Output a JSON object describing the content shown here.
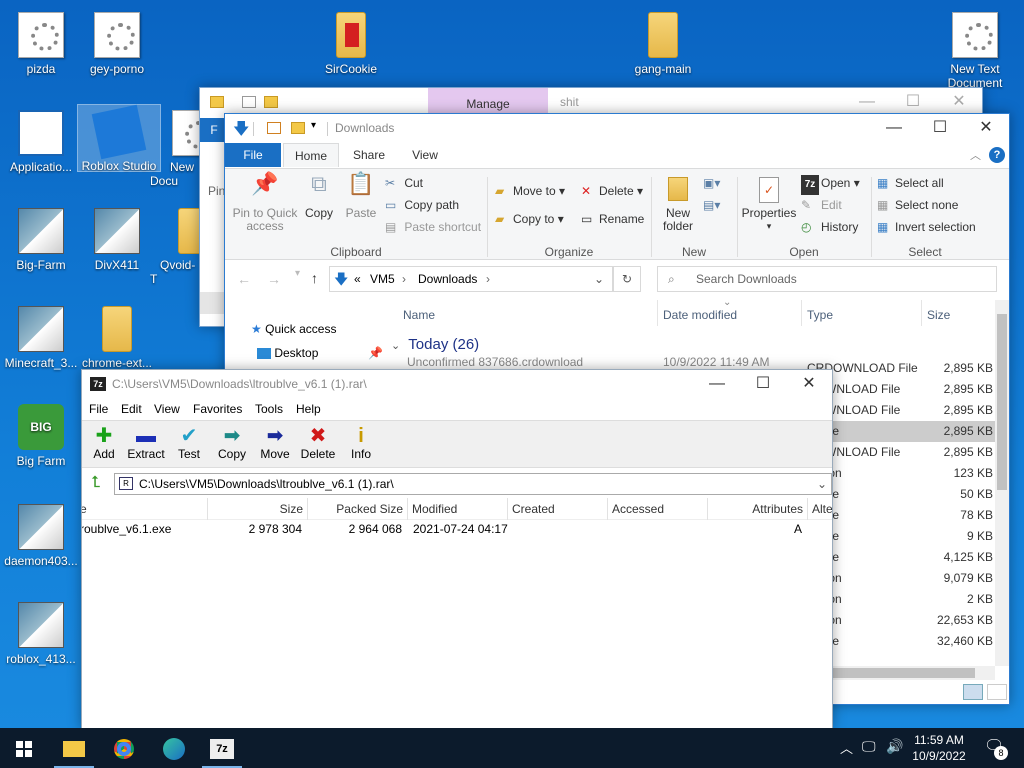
{
  "colors": {
    "accent": "#0078d7",
    "desktop": "#127fd8",
    "taskbar": "#0c1b2c",
    "ribbon_file": "#1a6fc4",
    "manage_tab": "#e4c8ef"
  },
  "desktop_icons": [
    {
      "label": "pizda",
      "icon": "text-file-icon"
    },
    {
      "label": "gey-porno",
      "icon": "text-file-icon"
    },
    {
      "label": "SirCookie",
      "icon": "archive-icon"
    },
    {
      "label": "gang-main",
      "icon": "archive-icon"
    },
    {
      "label": "New Text Document",
      "icon": "text-file-icon"
    },
    {
      "label": "Applicatio...",
      "icon": "window-icon"
    },
    {
      "label": "Roblox Studio",
      "icon": "roblox-icon"
    },
    {
      "label": "New Docu",
      "icon": "text-file-icon"
    },
    {
      "label": "Big-Farm",
      "icon": "setup-icon"
    },
    {
      "label": "DivX411",
      "icon": "setup-icon"
    },
    {
      "label": "Qvoid-T",
      "icon": "folder-icon"
    },
    {
      "label": "Minecraft_3...",
      "icon": "setup-icon"
    },
    {
      "label": "chrome-ext...",
      "icon": "folder-icon"
    },
    {
      "label": "Big Farm",
      "icon": "game-icon"
    },
    {
      "label": "daemon403...",
      "icon": "setup-icon"
    },
    {
      "label": "roblox_413...",
      "icon": "setup-icon"
    }
  ],
  "back_window": {
    "manage_tab": "Manage",
    "title": "shit",
    "file_tab": "F",
    "pin_label": "Pin"
  },
  "explorer": {
    "title": "Downloads",
    "tabs": [
      "File",
      "Home",
      "Share",
      "View"
    ],
    "clipboard": {
      "pin": "Pin to Quick access",
      "copy": "Copy",
      "paste": "Paste",
      "cut": "Cut",
      "copy_path": "Copy path",
      "paste_shortcut": "Paste shortcut",
      "group": "Clipboard"
    },
    "organize": {
      "move_to": "Move to",
      "copy_to": "Copy to",
      "delete": "Delete",
      "rename": "Rename",
      "group": "Organize"
    },
    "new": {
      "new_folder": "New folder",
      "group": "New"
    },
    "open": {
      "properties": "Properties",
      "open": "Open",
      "edit": "Edit",
      "history": "History",
      "group": "Open"
    },
    "select": {
      "select_all": "Select all",
      "select_none": "Select none",
      "invert": "Invert selection",
      "group": "Select"
    },
    "address": {
      "prefix": "«",
      "vm5": "VM5",
      "downloads": "Downloads"
    },
    "search_placeholder": "Search Downloads",
    "columns": {
      "name": "Name",
      "date": "Date modified",
      "type": "Type",
      "size": "Size"
    },
    "nav": {
      "quick_access": "Quick access",
      "desktop": "Desktop"
    },
    "group_header": "Today (26)",
    "rows": [
      {
        "type": "CRDOWNLOAD File",
        "size": "2,895 KB"
      },
      {
        "type": "DOWNLOAD File",
        "size": "2,895 KB"
      },
      {
        "type": "DOWNLOAD File",
        "size": "2,895 KB"
      },
      {
        "type": "rchive",
        "size": "2,895 KB",
        "selected": true
      },
      {
        "type": "DOWNLOAD File",
        "size": "2,895 KB"
      },
      {
        "type": "ication",
        "size": "123 KB"
      },
      {
        "type": "rchive",
        "size": "50 KB"
      },
      {
        "type": "rchive",
        "size": "78 KB"
      },
      {
        "type": "rchive",
        "size": "9 KB"
      },
      {
        "type": "rchive",
        "size": "4,125 KB"
      },
      {
        "type": "ication",
        "size": "9,079 KB"
      },
      {
        "type": "ication",
        "size": "2 KB"
      },
      {
        "type": "ication",
        "size": "22,653 KB"
      },
      {
        "type": "rchive",
        "size": "32,460 KB"
      }
    ],
    "first_row_name": "Unconfirmed 837686.crdownload",
    "first_row_date": "10/9/2022 11:49 AM"
  },
  "sevenzip": {
    "title": "C:\\Users\\VM5\\Downloads\\ltroublve_v6.1 (1).rar\\",
    "menu": [
      "File",
      "Edit",
      "View",
      "Favorites",
      "Tools",
      "Help"
    ],
    "toolbar": [
      {
        "label": "Add",
        "glyph": "✚",
        "color": "#1aa21a"
      },
      {
        "label": "Extract",
        "glyph": "▬",
        "color": "#1c2fb6"
      },
      {
        "label": "Test",
        "glyph": "✔",
        "color": "#22a0c8"
      },
      {
        "label": "Copy",
        "glyph": "➡",
        "color": "#1d8a88"
      },
      {
        "label": "Move",
        "glyph": "➡",
        "color": "#1a2a9a"
      },
      {
        "label": "Delete",
        "glyph": "✖",
        "color": "#d01818"
      },
      {
        "label": "Info",
        "glyph": "i",
        "color": "#c89a00"
      }
    ],
    "path": "C:\\Users\\VM5\\Downloads\\ltroublve_v6.1 (1).rar\\",
    "columns": [
      "e",
      "Size",
      "Packed Size",
      "Modified",
      "Created",
      "Accessed",
      "Attributes",
      "Alte"
    ],
    "files": [
      {
        "name": "roublve_v6.1.exe",
        "size": "2 978 304",
        "packed": "2 964 068",
        "modified": "2021-07-24 04:17",
        "created": "",
        "accessed": "",
        "attributes": "A"
      }
    ]
  },
  "taskbar": {
    "time": "11:59 AM",
    "date": "10/9/2022",
    "notifications": "8"
  }
}
